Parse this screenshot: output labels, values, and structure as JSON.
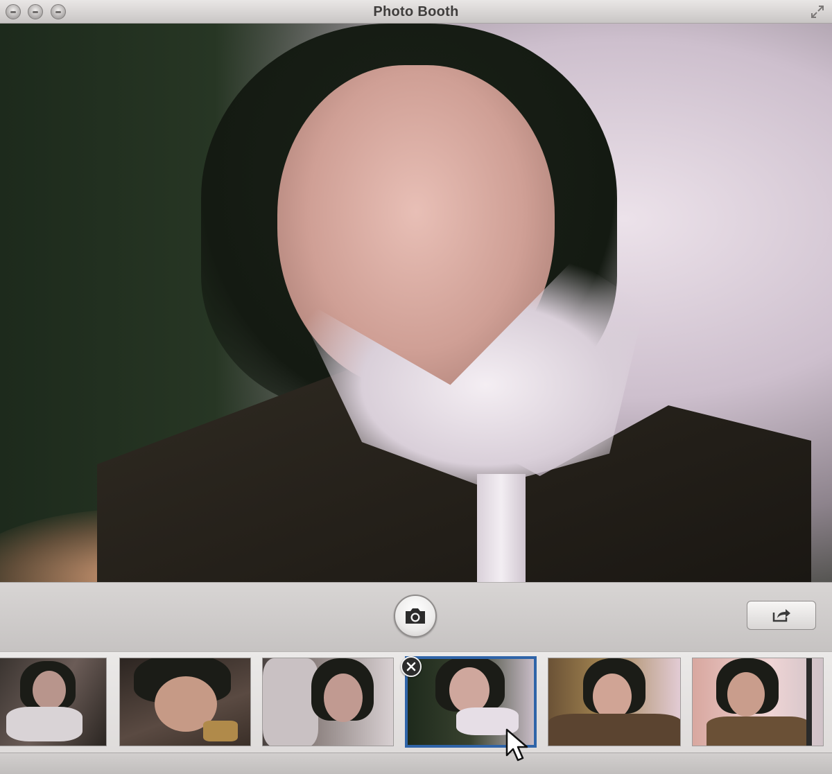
{
  "window": {
    "title": "Photo Booth",
    "buttons": [
      "close-button",
      "minimize-button",
      "zoom-button"
    ]
  },
  "toolbar": {
    "shutter_icon": "camera-icon",
    "share_icon": "share-arrow-icon"
  },
  "filmstrip": {
    "thumbnails": [
      {
        "index": 1,
        "selected": false
      },
      {
        "index": 2,
        "selected": false
      },
      {
        "index": 3,
        "selected": false
      },
      {
        "index": 4,
        "selected": true
      },
      {
        "index": 5,
        "selected": false
      },
      {
        "index": 6,
        "selected": false
      }
    ],
    "delete_icon": "close-x-icon"
  },
  "colors": {
    "selection": "#2f64a8",
    "chrome": "#d6d3d2",
    "titlebar_text": "#3f3d3c"
  }
}
